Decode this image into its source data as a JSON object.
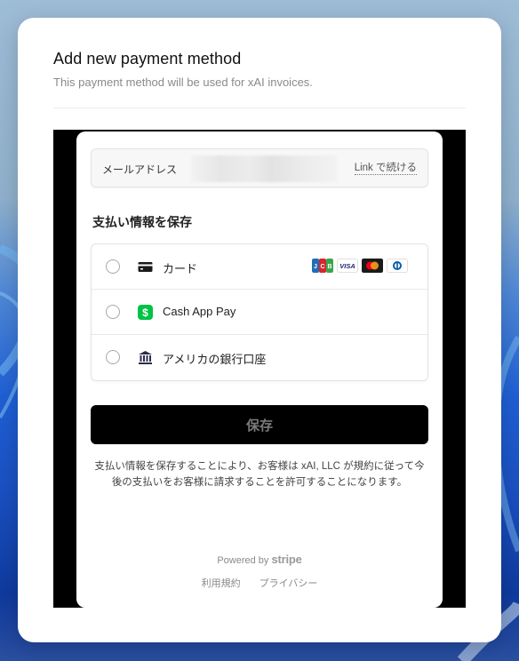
{
  "modal": {
    "title": "Add new payment method",
    "subtitle": "This payment method will be used for xAI invoices."
  },
  "stripe": {
    "email": {
      "label": "メールアドレス",
      "value_blurred": true,
      "link_label": "Link で続ける"
    },
    "section_heading": "支払い情報を保存",
    "methods": [
      {
        "id": "card",
        "label": "カード",
        "icon": "credit-card-icon",
        "selected": false,
        "brands": [
          "JCB",
          "VISA",
          "Mastercard",
          "Diners Club"
        ]
      },
      {
        "id": "cashapp",
        "label": "Cash App Pay",
        "icon": "cash-app-icon",
        "selected": false
      },
      {
        "id": "us_bank",
        "label": "アメリカの銀行口座",
        "icon": "bank-icon",
        "selected": false
      }
    ],
    "save_label": "保存",
    "consent_text": "支払い情報を保存することにより、お客様は xAI, LLC が規約に従って今後の支払いをお客様に請求することを許可することになります。",
    "powered_by": "Powered by",
    "powered_brand": "stripe",
    "footer_links": [
      "利用規約",
      "プライバシー"
    ]
  },
  "colors": {
    "cash_app_green": "#00c244",
    "bank_icon": "#2b2b4a",
    "button_bg": "#000000",
    "button_text": "#7a7a7a"
  }
}
